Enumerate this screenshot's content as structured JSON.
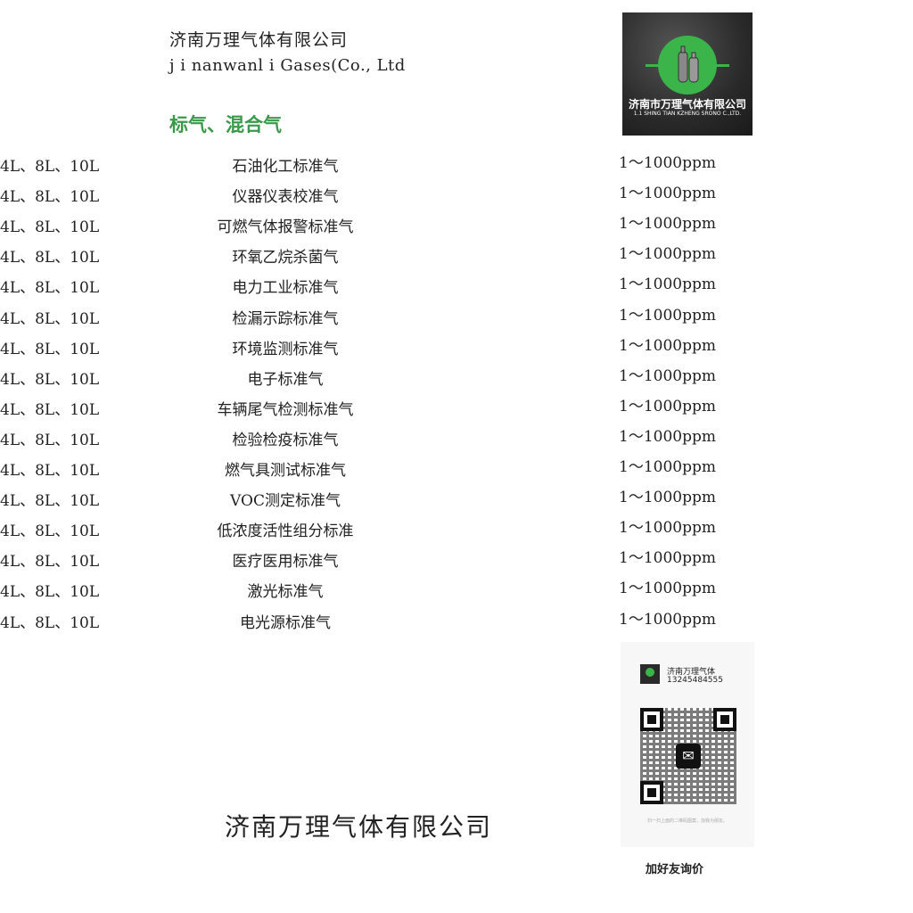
{
  "header": {
    "company_cn": "济南万理气体有限公司",
    "company_en": "j i nanwanl i  Gases(Co., Ltd"
  },
  "logo": {
    "icon": "gas-cylinder-icon",
    "company_cn": "济南市万理气体有限公司",
    "company_en": "1.1 SHING TIAN KZHENG SRONO C.,LTD.",
    "accent_color": "#3bb54a"
  },
  "section_title": "标气、混合气",
  "products": [
    {
      "name": "石油化工标准气",
      "sizes": "4L、8L、10L",
      "range": "1～1000ppm"
    },
    {
      "name": "仪器仪表校准气",
      "sizes": "4L、8L、10L",
      "range": "1～1000ppm"
    },
    {
      "name": "可燃气体报警标准气",
      "sizes": "4L、8L、10L",
      "range": "1～1000ppm"
    },
    {
      "name": "环氧乙烷杀菌气",
      "sizes": "4L、8L、10L",
      "range": "1～1000ppm"
    },
    {
      "name": "电力工业标准气",
      "sizes": "4L、8L、10L",
      "range": "1～1000ppm"
    },
    {
      "name": "检漏示踪标准气",
      "sizes": "4L、8L、10L",
      "range": "1～1000ppm"
    },
    {
      "name": "环境监测标准气",
      "sizes": "4L、8L、10L",
      "range": "1～1000ppm"
    },
    {
      "name": "电子标准气",
      "sizes": "4L、8L、10L",
      "range": "1～1000ppm"
    },
    {
      "name": "车辆尾气检测标准气",
      "sizes": "4L、8L、10L",
      "range": "1～1000ppm"
    },
    {
      "name": "检验检疫标准气",
      "sizes": "4L、8L、10L",
      "range": "1～1000ppm"
    },
    {
      "name": "燃气具测试标准气",
      "sizes": "4L、8L、10L",
      "range": "1～1000ppm"
    },
    {
      "name": "VOC测定标准气",
      "sizes": "4L、8L、10L",
      "range": "1～1000ppm"
    },
    {
      "name": "低浓度活性组分标准",
      "sizes": "4L、8L、10L",
      "range": "1～1000ppm"
    },
    {
      "name": "医疗医用标准气",
      "sizes": "4L、8L、10L",
      "range": "1～1000ppm"
    },
    {
      "name": "激光标准气",
      "sizes": "4L、8L、10L",
      "range": "1～1000ppm"
    },
    {
      "name": "电光源标准气",
      "sizes": "4L、8L、10L",
      "range": "1～1000ppm"
    }
  ],
  "contact_card": {
    "name": "济南万理气体",
    "phone": "13245484555",
    "qr_icon": "wechat-qr-code",
    "tip": "扫一扫上面的二维码图案，加我为朋友。"
  },
  "footer_company": "济南万理气体有限公司",
  "add_friend_label": "加好友询价"
}
